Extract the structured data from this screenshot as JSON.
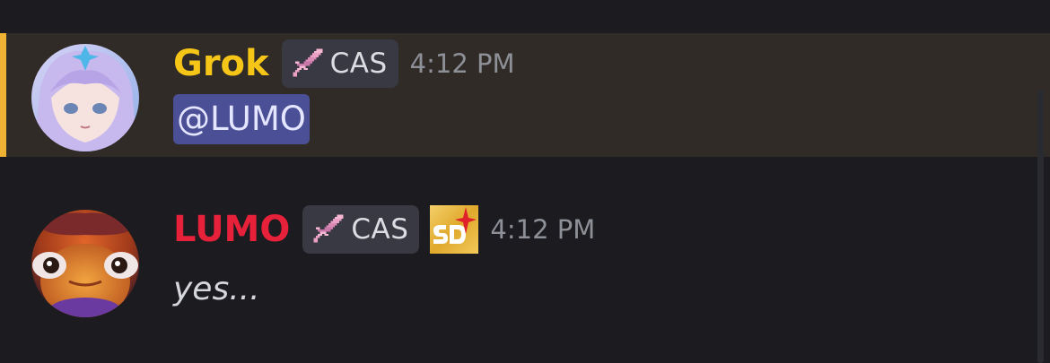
{
  "messages": [
    {
      "author": "Grok",
      "role_tag": "CAS",
      "timestamp": "4:12 PM",
      "mention": "@LUMO",
      "avatar_icon": "anime-avatar",
      "highlighted": true
    },
    {
      "author": "LUMO",
      "role_tag": "CAS",
      "server_badge_icon": "sd-badge-icon",
      "timestamp": "4:12 PM",
      "text": "yes...",
      "avatar_icon": "creature-avatar"
    }
  ],
  "colors": {
    "grok_name": "#f5c518",
    "lumo_name": "#e8213a",
    "mention_bg": "#4b4f95",
    "highlight_bg": "#302b27",
    "highlight_bar": "#f0b232",
    "background": "#1b1b20"
  }
}
